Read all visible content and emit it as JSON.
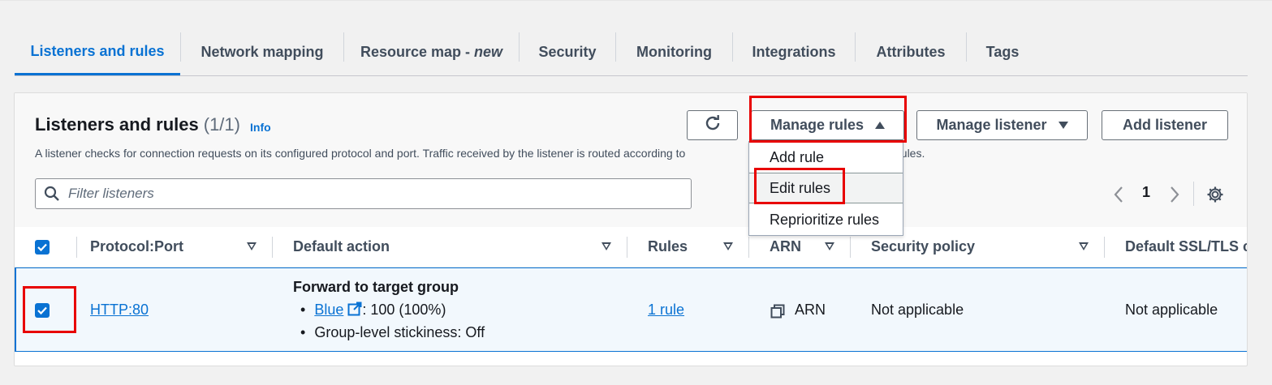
{
  "tabs": [
    {
      "label": "Listeners and rules"
    },
    {
      "label": "Network mapping"
    },
    {
      "label": "Resource map - ",
      "suffix": "new"
    },
    {
      "label": "Security"
    },
    {
      "label": "Monitoring"
    },
    {
      "label": "Integrations"
    },
    {
      "label": "Attributes"
    },
    {
      "label": "Tags"
    }
  ],
  "active_tab": "Listeners and rules",
  "header": {
    "title": "Listeners and rules",
    "count": "(1/1)",
    "info": "Info",
    "description": "A listener checks for connection requests on its configured protocol and port. Traffic received by the listener is routed according to",
    "description_tail": "additional rules."
  },
  "buttons": {
    "refresh_icon": "refresh-icon",
    "manage_rules": "Manage rules",
    "manage_listener": "Manage listener",
    "add_listener": "Add listener"
  },
  "search": {
    "placeholder": "Filter listeners",
    "icon": "search-icon"
  },
  "pagination": {
    "page": "1"
  },
  "menu": {
    "items": [
      {
        "label": "Add rule"
      },
      {
        "label": "Edit rules"
      },
      {
        "label": "Reprioritize rules"
      }
    ]
  },
  "table": {
    "columns": [
      "Protocol:Port",
      "Default action",
      "Rules",
      "ARN",
      "Security policy",
      "Default SSL/TLS certificate"
    ],
    "rows": [
      {
        "selected": true,
        "protocol_port": "HTTP:80",
        "default_action": {
          "title": "Forward to target group",
          "target_name": "Blue",
          "target_weight": ": 100 (100%)",
          "stickiness": "Group-level stickiness: Off"
        },
        "rules": "1 rule",
        "arn": "ARN",
        "security_policy": "Not applicable",
        "ssl_cert": "Not applicable"
      }
    ]
  },
  "colors": {
    "accent": "#0972d3",
    "highlight": "#e80000",
    "row_selected_bg": "#f2f8fd"
  }
}
